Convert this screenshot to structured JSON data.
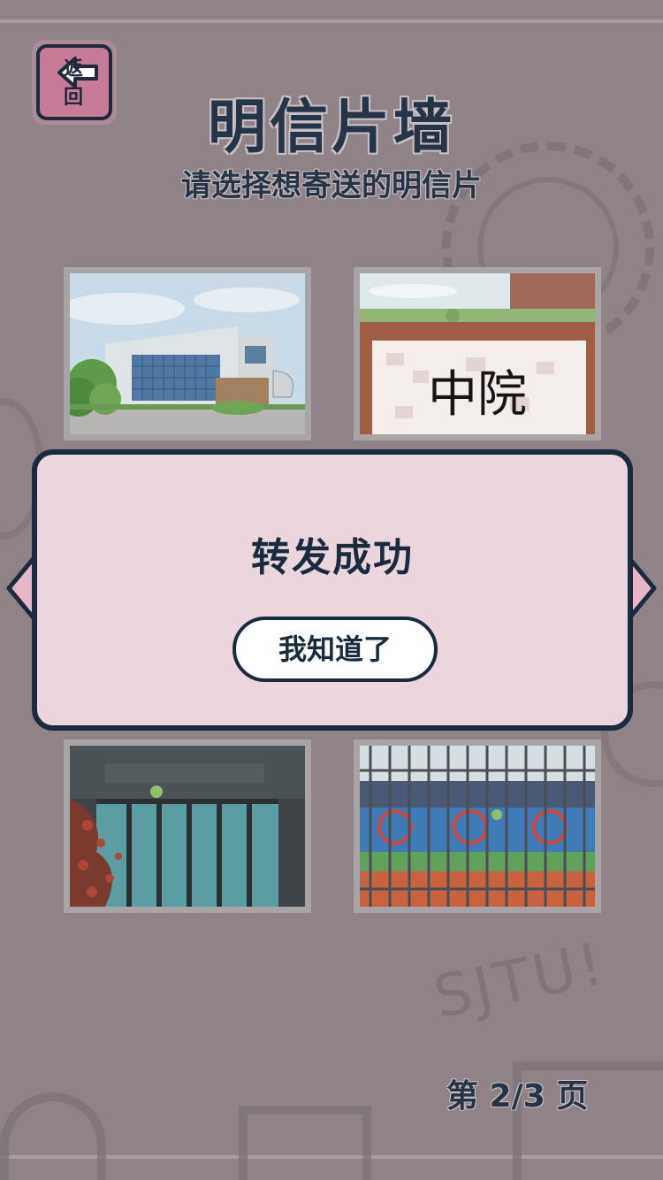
{
  "header": {
    "back_label": "返 回",
    "title": "明信片墙",
    "subtitle": "请选择想寄送的明信片"
  },
  "postcards": [
    {
      "scene": "modern building with glass facade"
    },
    {
      "scene": "brick wall with calligraphy sign",
      "sign_text": "中院"
    },
    {
      "scene": "library entrance with glass doors and red tree"
    },
    {
      "scene": "stadium behind iron gate"
    }
  ],
  "pagination": {
    "label": "第 2/3 页"
  },
  "decor": {
    "doodle_text": "SJTU!"
  },
  "modal": {
    "message": "转发成功",
    "button_label": "我知道了"
  },
  "colors": {
    "background": "#8f8387",
    "modal_bg": "#ecd6dd",
    "ink": "#1b2b3e",
    "back_button": "#c77b96"
  }
}
